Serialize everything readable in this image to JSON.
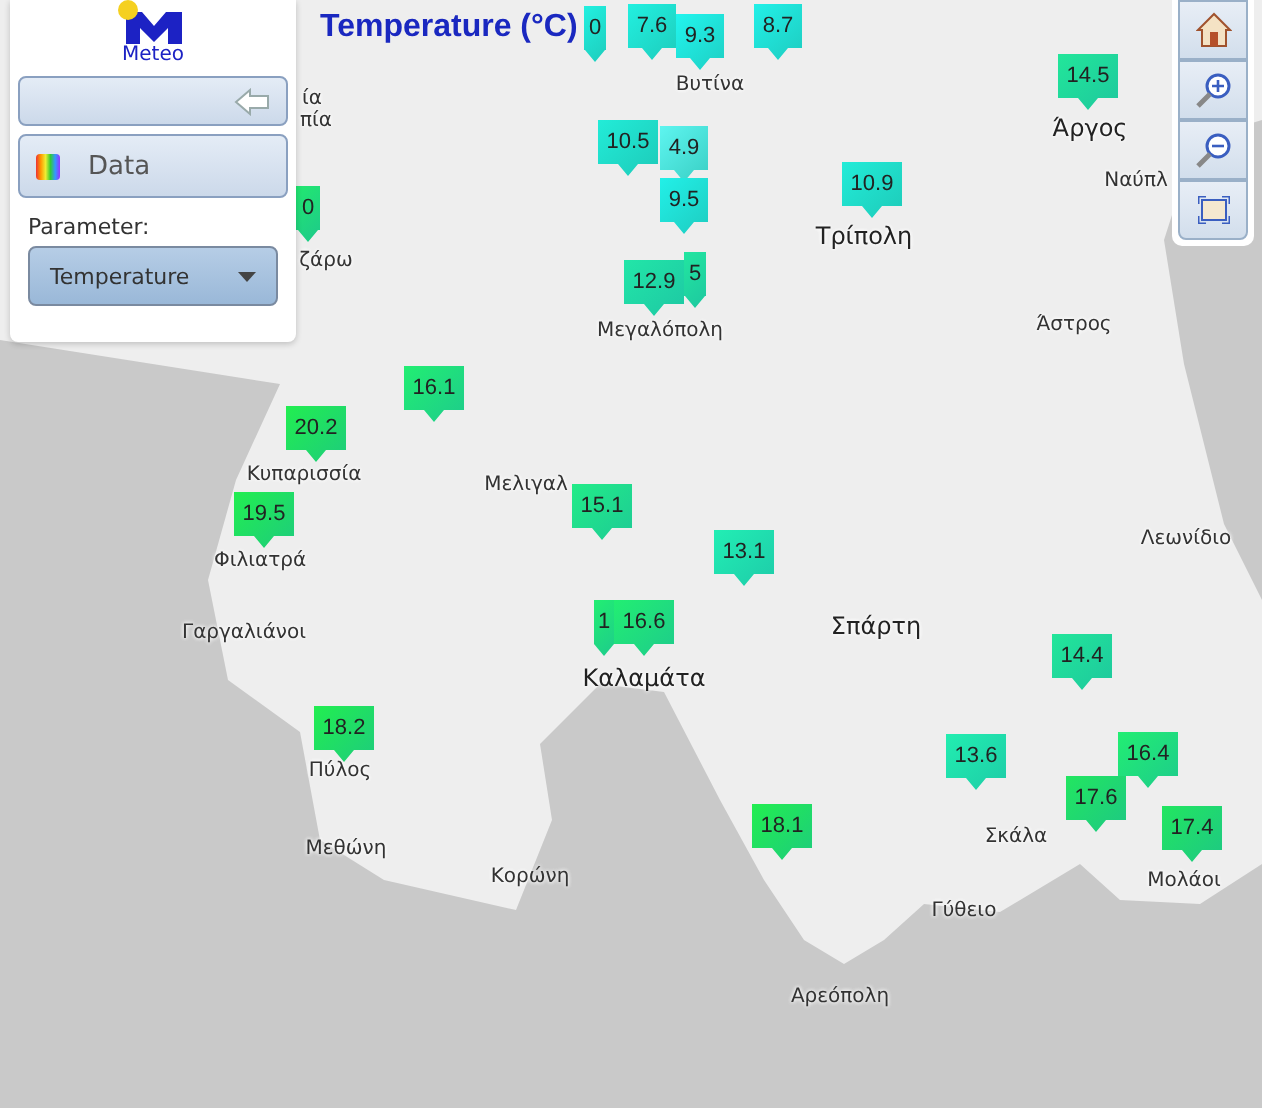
{
  "title": "Temperature (°C)",
  "logo": {
    "text": "Meteo"
  },
  "panel": {
    "section": "Data",
    "parameter_label": "Parameter:",
    "parameter_value": "Temperature"
  },
  "markers": [
    {
      "value": "0",
      "color": "#22f0e0"
    },
    {
      "value": "7.6",
      "color": "#22f0e0"
    },
    {
      "value": "9.3",
      "color": "#22f5ee"
    },
    {
      "value": "8.7",
      "color": "#22f0e8"
    },
    {
      "value": "14.5",
      "color": "#22e69a"
    },
    {
      "value": "10.5",
      "color": "#22ecd8"
    },
    {
      "value": "4.9",
      "color": "#5ef5f0"
    },
    {
      "value": "10.9",
      "color": "#22ecd8"
    },
    {
      "value": "9.5",
      "color": "#22f0e8"
    },
    {
      "value": "0",
      "color": "#22e870"
    },
    {
      "value": "5",
      "color": "#22e6a0"
    },
    {
      "value": "12.9",
      "color": "#22e6a8"
    },
    {
      "value": "16.1",
      "color": "#22ee72"
    },
    {
      "value": "20.2",
      "color": "#22ee50"
    },
    {
      "value": "19.5",
      "color": "#22ee50"
    },
    {
      "value": "15.1",
      "color": "#22ec88"
    },
    {
      "value": "13.1",
      "color": "#22eeb4"
    },
    {
      "value": "1",
      "color": "#22ee72"
    },
    {
      "value": "16.6",
      "color": "#22ee72"
    },
    {
      "value": "14.4",
      "color": "#22e69a"
    },
    {
      "value": "18.2",
      "color": "#22ee50"
    },
    {
      "value": "13.6",
      "color": "#22eeb0"
    },
    {
      "value": "16.4",
      "color": "#22ee72"
    },
    {
      "value": "17.6",
      "color": "#22e660"
    },
    {
      "value": "18.1",
      "color": "#22ee50"
    },
    {
      "value": "17.4",
      "color": "#22e660"
    }
  ],
  "places": [
    "ία",
    "πία",
    "ζάρω",
    "Βυτίνα",
    "Άργος",
    "Ναύπλ",
    "Τρίπολη",
    "Μεγαλόπολη",
    "Άστρος",
    "Κυπαρισσία",
    "Μελιγαλ",
    "Φιλιατρά",
    "Λεωνίδιο",
    "Σπάρτη",
    "Γαργαλιάνοι",
    "Καλαμάτα",
    "Πύλος",
    "Σκάλα",
    "Μεθώνη",
    "Μολάοι",
    "Κορώνη",
    "Γύθειο",
    "Αρεόπολη"
  ]
}
